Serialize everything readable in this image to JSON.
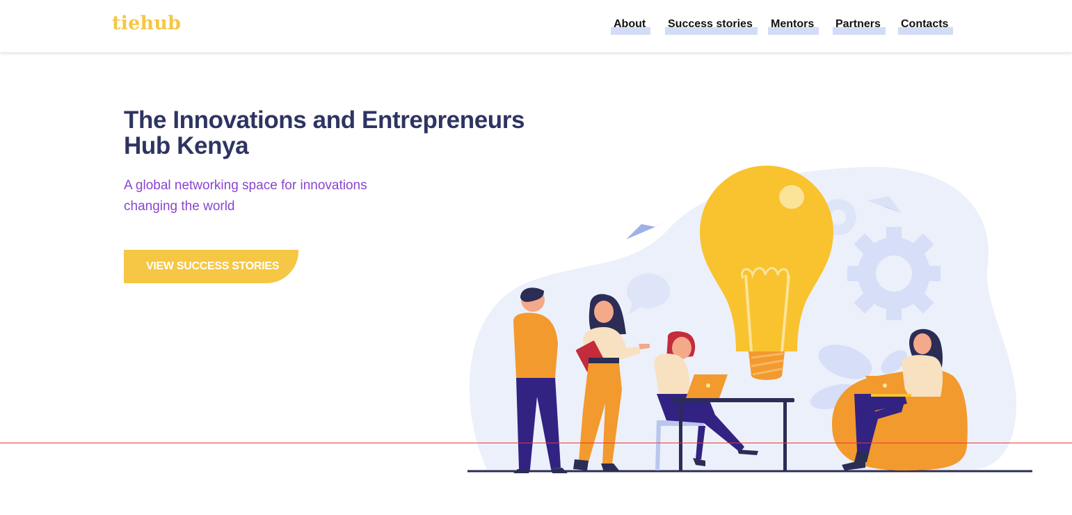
{
  "header": {
    "logo": "tiehub",
    "nav": [
      {
        "label": "About"
      },
      {
        "label": "Success stories"
      },
      {
        "label": "Mentors"
      },
      {
        "label": "Partners"
      },
      {
        "label": "Contacts"
      }
    ]
  },
  "hero": {
    "title": "The Innovations and Entrepreneurs Hub Kenya",
    "subtitle": "A global networking space for innovations changing the world",
    "cta_label": "VIEW SUCCESS STORIES"
  },
  "colors": {
    "brand_yellow": "#f6c744",
    "title_navy": "#2e3461",
    "subtitle_purple": "#8a44d0",
    "nav_highlight": "#d3dcf7"
  },
  "icons": [
    "lightbulb-icon",
    "gear-icon",
    "paper-plane-icon",
    "speech-bubble-icon",
    "laptop-icon"
  ]
}
